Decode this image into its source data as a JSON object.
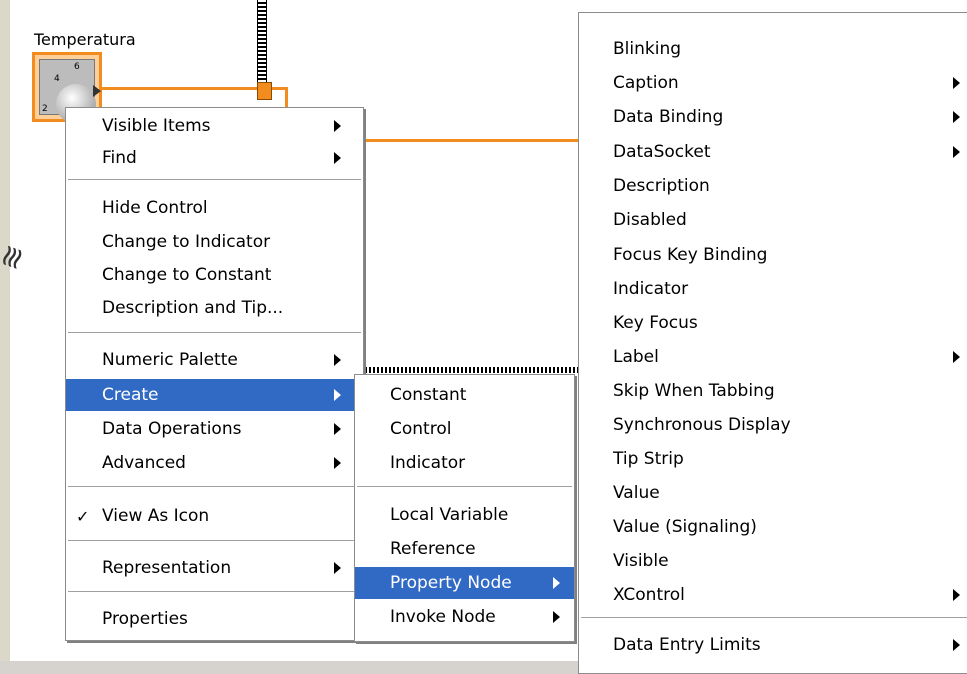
{
  "control": {
    "label": "Temperatura",
    "icon": "knob-icon",
    "scale": [
      "4",
      "6",
      "2"
    ]
  },
  "context_menu": {
    "items": [
      {
        "label": "Visible Items",
        "submenu": true
      },
      {
        "label": "Find",
        "submenu": true
      },
      {
        "label": "Hide Control",
        "submenu": false
      },
      {
        "label": "Change to Indicator",
        "submenu": false
      },
      {
        "label": "Change to Constant",
        "submenu": false
      },
      {
        "label": "Description and Tip...",
        "submenu": false
      },
      {
        "label": "Numeric Palette",
        "submenu": true
      },
      {
        "label": "Create",
        "submenu": true,
        "highlighted": true
      },
      {
        "label": "Data Operations",
        "submenu": true
      },
      {
        "label": "Advanced",
        "submenu": true
      },
      {
        "label": "View As Icon",
        "submenu": false,
        "checked": true
      },
      {
        "label": "Representation",
        "submenu": true
      },
      {
        "label": "Properties",
        "submenu": false
      }
    ],
    "check_glyph": "✓"
  },
  "create_menu": {
    "items": [
      {
        "label": "Constant",
        "submenu": false
      },
      {
        "label": "Control",
        "submenu": false
      },
      {
        "label": "Indicator",
        "submenu": false
      },
      {
        "label": "Local Variable",
        "submenu": false
      },
      {
        "label": "Reference",
        "submenu": false
      },
      {
        "label": "Property Node",
        "submenu": true,
        "highlighted": true
      },
      {
        "label": "Invoke Node",
        "submenu": true
      }
    ]
  },
  "property_menu": {
    "items": [
      {
        "label": "Blinking",
        "submenu": false
      },
      {
        "label": "Caption",
        "submenu": true
      },
      {
        "label": "Data Binding",
        "submenu": true
      },
      {
        "label": "DataSocket",
        "submenu": true
      },
      {
        "label": "Description",
        "submenu": false
      },
      {
        "label": "Disabled",
        "submenu": false
      },
      {
        "label": "Focus Key Binding",
        "submenu": false
      },
      {
        "label": "Indicator",
        "submenu": false
      },
      {
        "label": "Key Focus",
        "submenu": false
      },
      {
        "label": "Label",
        "submenu": true
      },
      {
        "label": "Skip When Tabbing",
        "submenu": false
      },
      {
        "label": "Synchronous Display",
        "submenu": false
      },
      {
        "label": "Tip Strip",
        "submenu": false
      },
      {
        "label": "Value",
        "submenu": false
      },
      {
        "label": "Value (Signaling)",
        "submenu": false
      },
      {
        "label": "Visible",
        "submenu": false
      },
      {
        "label": "XControl",
        "submenu": true
      },
      {
        "label": "Data Entry Limits",
        "submenu": true
      }
    ]
  },
  "colors": {
    "highlight": "#316ac5",
    "wire": "#f28c1e"
  }
}
